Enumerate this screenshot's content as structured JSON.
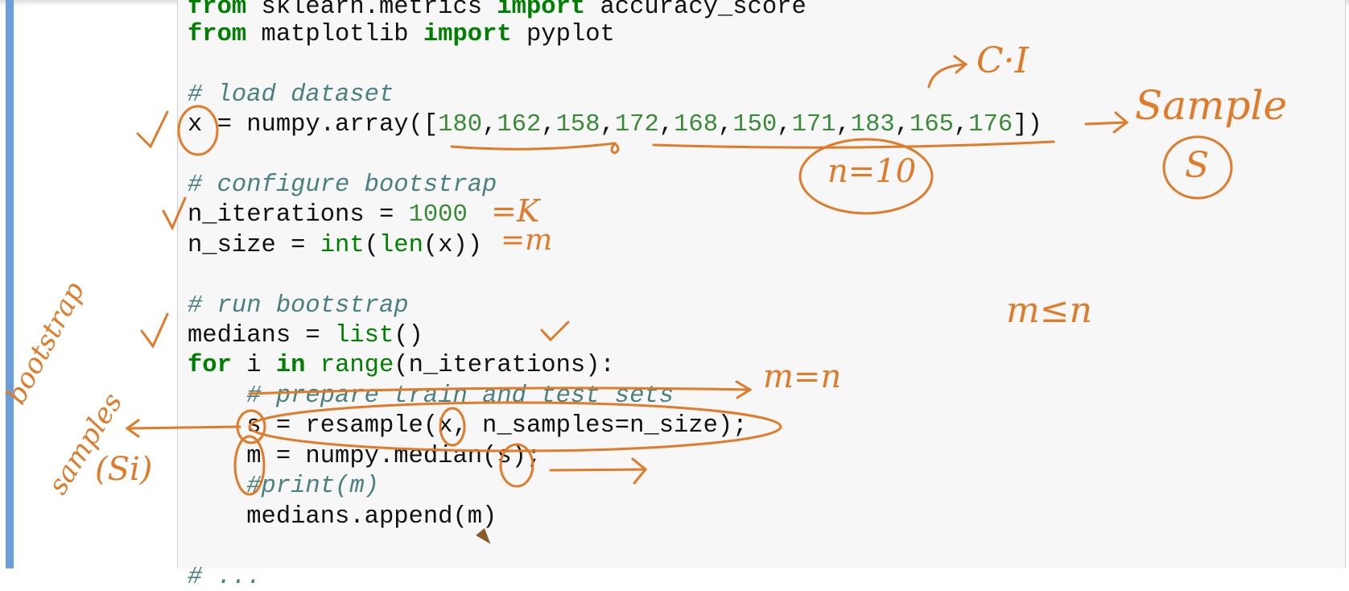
{
  "code_lines": [
    [
      {
        "t": "from",
        "c": "kw"
      },
      {
        "t": " sklearn.metrics ",
        "c": ""
      },
      {
        "t": "import",
        "c": "kw"
      },
      {
        "t": " accuracy_score",
        "c": ""
      }
    ],
    [
      {
        "t": "from",
        "c": "kw"
      },
      {
        "t": " matplotlib ",
        "c": ""
      },
      {
        "t": "import",
        "c": "kw"
      },
      {
        "t": " pyplot",
        "c": ""
      }
    ],
    [],
    [
      {
        "t": "# load dataset",
        "c": "cm"
      }
    ],
    [
      {
        "t": "x = numpy.array([",
        "c": ""
      },
      {
        "t": "180",
        "c": "num"
      },
      {
        "t": ",",
        "c": ""
      },
      {
        "t": "162",
        "c": "num"
      },
      {
        "t": ",",
        "c": ""
      },
      {
        "t": "158",
        "c": "num"
      },
      {
        "t": ",",
        "c": ""
      },
      {
        "t": "172",
        "c": "num"
      },
      {
        "t": ",",
        "c": ""
      },
      {
        "t": "168",
        "c": "num"
      },
      {
        "t": ",",
        "c": ""
      },
      {
        "t": "150",
        "c": "num"
      },
      {
        "t": ",",
        "c": ""
      },
      {
        "t": "171",
        "c": "num"
      },
      {
        "t": ",",
        "c": ""
      },
      {
        "t": "183",
        "c": "num"
      },
      {
        "t": ",",
        "c": ""
      },
      {
        "t": "165",
        "c": "num"
      },
      {
        "t": ",",
        "c": ""
      },
      {
        "t": "176",
        "c": "num"
      },
      {
        "t": "])",
        "c": ""
      }
    ],
    [],
    [
      {
        "t": "# configure bootstrap",
        "c": "cm"
      }
    ],
    [
      {
        "t": "n_iterations = ",
        "c": ""
      },
      {
        "t": "1000",
        "c": "num"
      }
    ],
    [
      {
        "t": "n_size = ",
        "c": ""
      },
      {
        "t": "int",
        "c": "bi"
      },
      {
        "t": "(",
        "c": ""
      },
      {
        "t": "len",
        "c": "bi"
      },
      {
        "t": "(x))",
        "c": ""
      }
    ],
    [],
    [
      {
        "t": "# run bootstrap",
        "c": "cm"
      }
    ],
    [
      {
        "t": "medians = ",
        "c": ""
      },
      {
        "t": "list",
        "c": "bi"
      },
      {
        "t": "()",
        "c": ""
      }
    ],
    [
      {
        "t": "for",
        "c": "kw"
      },
      {
        "t": " i ",
        "c": ""
      },
      {
        "t": "in",
        "c": "kw"
      },
      {
        "t": " ",
        "c": ""
      },
      {
        "t": "range",
        "c": "bi"
      },
      {
        "t": "(n_iterations):",
        "c": ""
      }
    ],
    [
      {
        "t": "    ",
        "c": ""
      },
      {
        "t": "# prepare train and test sets",
        "c": "cm"
      }
    ],
    [
      {
        "t": "    s = resample(x, n_samples=n_size);",
        "c": ""
      }
    ],
    [
      {
        "t": "    m = numpy.median(s);",
        "c": ""
      }
    ],
    [
      {
        "t": "    ",
        "c": ""
      },
      {
        "t": "#print(m)",
        "c": "cm"
      }
    ],
    [
      {
        "t": "    medians.append(m)",
        "c": ""
      }
    ],
    [],
    [
      {
        "t": "# ...",
        "c": "cm"
      }
    ]
  ],
  "annotations": {
    "ci": "C·I",
    "sample": "Sample",
    "s_circled": "S",
    "n_equals": "n=10",
    "eq_k": "=K",
    "eq_m": "=m",
    "m_le_n": "m≤n",
    "m_eq_n": "m=n",
    "bootstrap": "bootstrap",
    "samples": "samples",
    "si": "(Si)"
  },
  "colors": {
    "annotation": "#e07b2a",
    "keyword": "#008000",
    "comment": "#4a8080",
    "sidebar": "#6a9fdc"
  },
  "cursor": "pencil-icon"
}
